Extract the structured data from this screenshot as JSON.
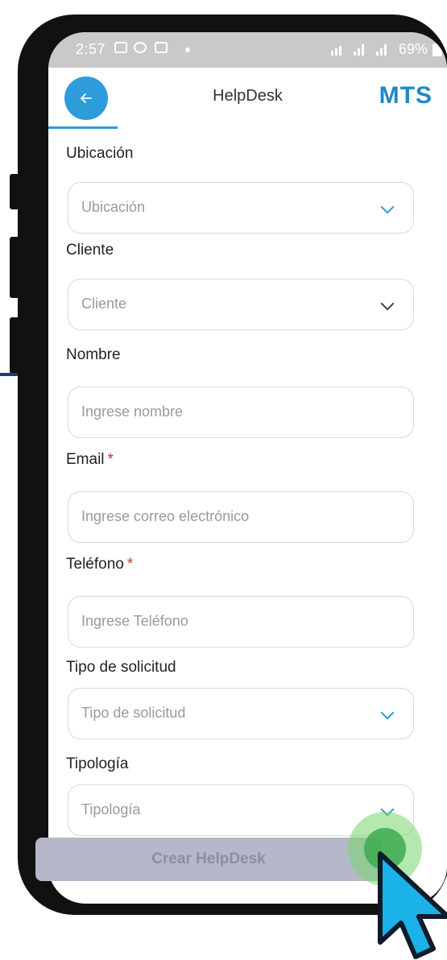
{
  "status_bar": {
    "time": "2:57",
    "battery": "69%"
  },
  "header": {
    "title": "HelpDesk",
    "logo": "MTS"
  },
  "form": {
    "ubicacion": {
      "label": "Ubicación",
      "placeholder": "Ubicación"
    },
    "cliente": {
      "label": "Cliente",
      "placeholder": "Cliente"
    },
    "nombre": {
      "label": "Nombre",
      "placeholder": "Ingrese nombre"
    },
    "email": {
      "label": "Email",
      "required_mark": "*",
      "placeholder": "Ingrese correo electrónico"
    },
    "telefono": {
      "label": "Teléfono",
      "required_mark": "*",
      "placeholder": "Ingrese Teléfono"
    },
    "tipo_solicitud": {
      "label": "Tipo de solicitud",
      "placeholder": "Tipo de solicitud"
    },
    "tipologia": {
      "label": "Tipología",
      "placeholder": "Tipología"
    }
  },
  "submit": {
    "label": "Crear HelpDesk"
  },
  "colors": {
    "accent": "#2d9cdb",
    "button_disabled": "#b4b8c9",
    "required": "#c0392b",
    "cursor": "#1ab2e8",
    "ripple": "#4caf50"
  }
}
